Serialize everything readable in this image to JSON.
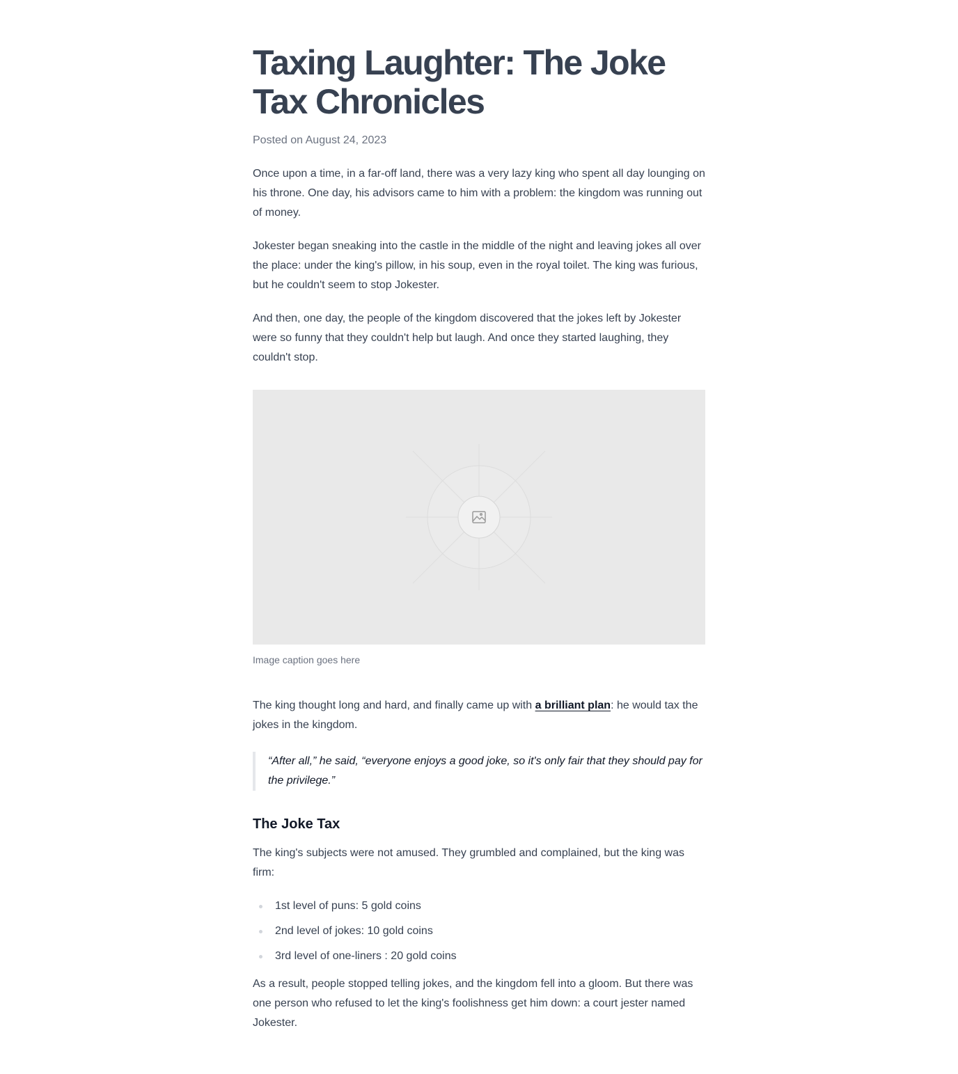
{
  "article": {
    "title": "Taxing Laughter: The Joke Tax Chronicles",
    "meta": "Posted on August 24, 2023",
    "paragraphs": [
      "Once upon a time, in a far-off land, there was a very lazy king who spent all day lounging on his throne. One day, his advisors came to him with a problem: the kingdom was running out of money.",
      "Jokester began sneaking into the castle in the middle of the night and leaving jokes all over the place: under the king's pillow, in his soup, even in the royal toilet. The king was furious, but he couldn't seem to stop Jokester.",
      "And then, one day, the people of the kingdom discovered that the jokes left by Jokester were so funny that they couldn't help but laugh. And once they started laughing, they couldn't stop."
    ],
    "figure": {
      "icon": "image-icon",
      "caption": "Image caption goes here",
      "background": "#e9e9e9"
    },
    "plan_paragraph": {
      "before": "The king thought long and hard, and finally came up with ",
      "link": "a brilliant plan",
      "after": ": he would tax the jokes in the kingdom."
    },
    "quote": "“After all,” he said, “everyone enjoys a good joke, so it's only fair that they should pay for the privilege.”",
    "section_heading": "The Joke Tax",
    "section_paragraph": "The king's subjects were not amused. They grumbled and complained, but the king was firm:",
    "tax_list": [
      "1st level of puns: 5 gold coins",
      "2nd level of jokes: 10 gold coins",
      "3rd level of one-liners : 20 gold coins"
    ],
    "closing_paragraph": "As a result, people stopped telling jokes, and the kingdom fell into a gloom. But there was one person who refused to let the king's foolishness get him down: a court jester named Jokester."
  },
  "colors": {
    "title": "#374151",
    "body": "#374151",
    "muted": "#6b7280",
    "strong": "#111827",
    "quote_border": "#e5e7eb"
  }
}
